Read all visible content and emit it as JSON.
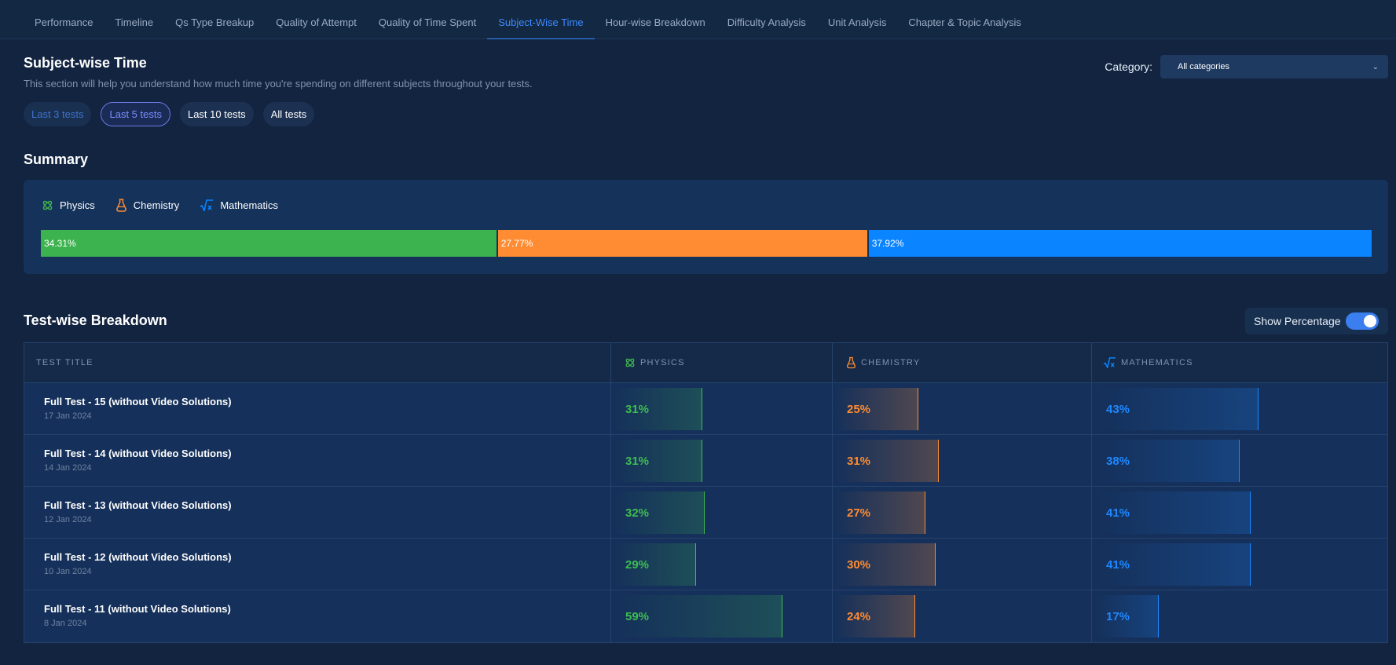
{
  "nav": {
    "tabs": [
      {
        "label": "Performance",
        "active": false
      },
      {
        "label": "Timeline",
        "active": false
      },
      {
        "label": "Qs Type Breakup",
        "active": false
      },
      {
        "label": "Quality of Attempt",
        "active": false
      },
      {
        "label": "Quality of Time Spent",
        "active": false
      },
      {
        "label": "Subject-Wise Time",
        "active": true
      },
      {
        "label": "Hour-wise Breakdown",
        "active": false
      },
      {
        "label": "Difficulty Analysis",
        "active": false
      },
      {
        "label": "Unit Analysis",
        "active": false
      },
      {
        "label": "Chapter & Topic Analysis",
        "active": false
      }
    ]
  },
  "header": {
    "title": "Subject-wise Time",
    "description": "This section will help you understand how much time you're spending on different subjects throughout your tests."
  },
  "category": {
    "label": "Category:",
    "selected": "All categories"
  },
  "filters": {
    "pills": [
      {
        "label": "Last 3 tests",
        "state": "dim"
      },
      {
        "label": "Last 5 tests",
        "state": "selected"
      },
      {
        "label": "Last 10 tests",
        "state": "normal"
      },
      {
        "label": "All tests",
        "state": "normal"
      }
    ]
  },
  "summary": {
    "title": "Summary",
    "subjects": [
      {
        "name": "Physics",
        "icon": "physics-icon",
        "color": "#3db34f",
        "percent": 34.31,
        "label": "34.31%"
      },
      {
        "name": "Chemistry",
        "icon": "chemistry-flask-icon",
        "color": "#ff8c32",
        "percent": 27.77,
        "label": "27.77%"
      },
      {
        "name": "Mathematics",
        "icon": "mathematics-sqrt-icon",
        "color": "#0a84ff",
        "percent": 37.92,
        "label": "37.92%"
      }
    ]
  },
  "breakdown": {
    "title": "Test-wise Breakdown",
    "toggle_label": "Show Percentage",
    "toggle_on": true,
    "columns": [
      "TEST TITLE",
      "PHYSICS",
      "CHEMISTRY",
      "MATHEMATICS"
    ],
    "rows": [
      {
        "title": "Full Test - 15 (without Video Solutions)",
        "date": "17 Jan 2024",
        "physics": 31,
        "chemistry": 25,
        "mathematics": 43
      },
      {
        "title": "Full Test - 14 (without Video Solutions)",
        "date": "14 Jan 2024",
        "physics": 31,
        "chemistry": 31,
        "mathematics": 38
      },
      {
        "title": "Full Test - 13 (without Video Solutions)",
        "date": "12 Jan 2024",
        "physics": 32,
        "chemistry": 27,
        "mathematics": 41
      },
      {
        "title": "Full Test - 12 (without Video Solutions)",
        "date": "10 Jan 2024",
        "physics": 29,
        "chemistry": 30,
        "mathematics": 41
      },
      {
        "title": "Full Test - 11 (without Video Solutions)",
        "date": "8 Jan 2024",
        "physics": 59,
        "chemistry": 24,
        "mathematics": 17
      }
    ]
  }
}
